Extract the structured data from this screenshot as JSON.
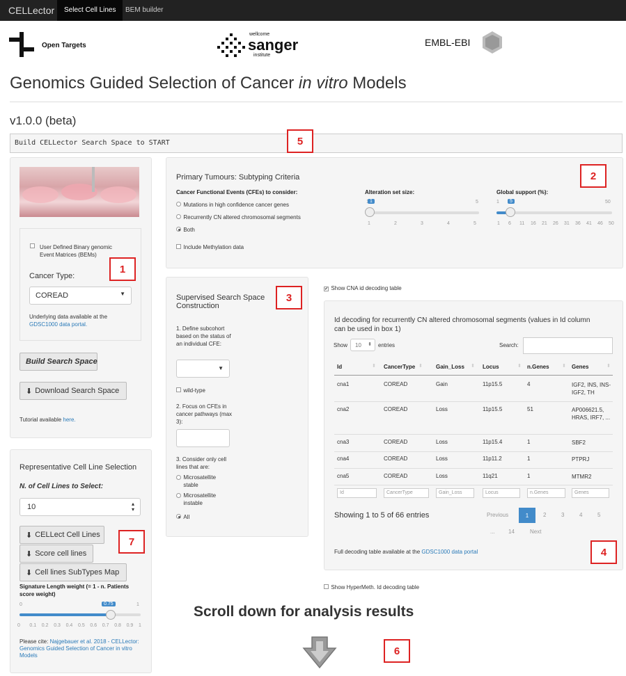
{
  "nav": {
    "brand": "CELLector",
    "tabs": [
      "Select Cell Lines",
      "BEM builder"
    ]
  },
  "logos": {
    "open_targets": "Open Targets",
    "sanger_small": "wellcome",
    "sanger_big": "sanger",
    "sanger_sub": "institute",
    "embl": "EMBL-EBI"
  },
  "page": {
    "title_pre": "Genomics Guided Selection of Cancer ",
    "title_em": "in vitro",
    "title_post": " Models",
    "version": "v1.0.0 (beta)",
    "status": "Build CELLector Search Space to START"
  },
  "markers": [
    "1",
    "2",
    "3",
    "4",
    "5",
    "6",
    "7"
  ],
  "left": {
    "bem_label": "User Defined Binary genomic Event Matrices (BEMs)",
    "cancer_type_label": "Cancer Type:",
    "cancer_type_value": "COREAD",
    "data_note": "Underlying data available at the",
    "data_link": "GDSC1000 data portal.",
    "build_btn": "Build Search Space",
    "download_btn": "Download Search Space",
    "tutorial_pre": "Tutorial available ",
    "tutorial_link": "here."
  },
  "rep": {
    "title": "Representative Cell Line Selection",
    "n_label": "N. of Cell Lines to Select:",
    "n_value": "10",
    "btn_cellect": "CELLect Cell Lines",
    "btn_score": "Score cell lines",
    "btn_map": "Cell lines SubTypes Map",
    "sig_label": "Signature Length weight (= 1 - n. Patients score weight)",
    "sig_min": "0",
    "sig_max": "1",
    "sig_value": "0.75",
    "sig_level": 0.75,
    "sig_ticks": [
      "0",
      "0.1",
      "0.2",
      "0.3",
      "0.4",
      "0.5",
      "0.6",
      "0.7",
      "0.8",
      "0.9",
      "1"
    ],
    "cite_pre": "Please cite: ",
    "cite_link": "Najgebauer et al. 2018 - CELLector: Genomics Guided Selection of Cancer in vitro Models"
  },
  "primary": {
    "title": "Primary Tumours: Subtyping Criteria",
    "cfe_label": "Cancer Functional Events (CFEs) to consider:",
    "options": [
      "Mutations in high confidence cancer genes",
      "Recurrently CN altered chromosomal segments",
      "Both"
    ],
    "selected": 2,
    "methylation": "Include Methylation data",
    "alt_label": "Alteration set size:",
    "alt_min": "1",
    "alt_max": "5",
    "alt_value": "1",
    "alt_ticks": [
      "1",
      "2",
      "3",
      "4",
      "5"
    ],
    "glob_label": "Global support (%):",
    "glob_min": "1",
    "glob_max": "50",
    "glob_value": "5",
    "glob_ticks": [
      "1",
      "6",
      "11",
      "16",
      "21",
      "26",
      "31",
      "36",
      "41",
      "46",
      "50"
    ]
  },
  "supervised": {
    "title": "Supervised Search Space Construction",
    "step1": "1. Define subcohort based on the status of an individual CFE:",
    "wild": "wild-type",
    "step2": "2. Focus on CFEs in cancer pathways (max 3):",
    "step3": "3. Consider only cell lines that are:",
    "ms_options": [
      "Microsatellite stable",
      "Microsatellite instable",
      "All"
    ],
    "ms_selected": 2
  },
  "cna": {
    "show_label": "Show CNA id decoding table",
    "title": "Id decoding for recurrently CN altered chromosomal segments (values in Id column can be used in box 1)",
    "show": "Show",
    "entries": "entries",
    "show_n": "10",
    "search": "Search:",
    "columns": [
      "Id",
      "CancerType",
      "Gain_Loss",
      "Locus",
      "n.Genes",
      "Genes"
    ],
    "rows": [
      [
        "cna1",
        "COREAD",
        "Gain",
        "11p15.5",
        "4",
        "IGF2, INS, INS-IGF2, TH"
      ],
      [
        "cna2",
        "COREAD",
        "Loss",
        "11p15.5",
        "51",
        "AP006621.5, HRAS, IRF7, ..."
      ],
      [
        "cna3",
        "COREAD",
        "Loss",
        "11p15.4",
        "1",
        "SBF2"
      ],
      [
        "cna4",
        "COREAD",
        "Loss",
        "11p11.2",
        "1",
        "PTPRJ"
      ],
      [
        "cna5",
        "COREAD",
        "Loss",
        "11q21",
        "1",
        "MTMR2"
      ]
    ],
    "info": "Showing 1 to 5 of 66 entries",
    "pagination": {
      "prev": "Previous",
      "pages": [
        "1",
        "2",
        "3",
        "4",
        "5"
      ],
      "ellipsis": "...",
      "last": "14",
      "next": "Next"
    },
    "footer_pre": "Full decoding table available at the ",
    "footer_link": "GDSC1000 data portal"
  },
  "hyper": "Show HyperMeth. Id decoding table",
  "scroll": "Scroll down for analysis results"
}
